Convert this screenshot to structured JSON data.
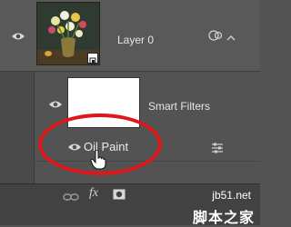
{
  "layer": {
    "name": "Layer 0"
  },
  "smart_filters": {
    "label": "Smart Filters"
  },
  "filter": {
    "name": "Oil Paint"
  },
  "footer": {
    "fx_label": "fx"
  },
  "watermark": {
    "site": "jb51.net",
    "text": "脚本之家"
  },
  "colors": {
    "panel": "#535353",
    "highlight_ring": "#e0161b"
  }
}
